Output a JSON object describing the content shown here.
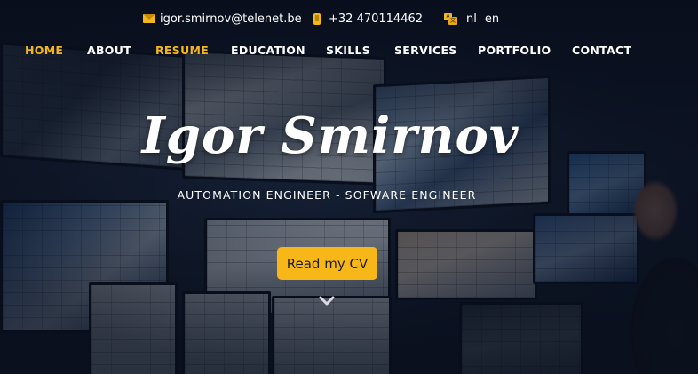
{
  "contact": {
    "email": "igor.smirnov@telenet.be",
    "phone": "+32 470114462",
    "languages": [
      "nl",
      "en"
    ]
  },
  "nav": {
    "items": [
      {
        "label": "HOME",
        "active": true
      },
      {
        "label": "ABOUT",
        "active": false
      },
      {
        "label": "RESUME",
        "active": true
      },
      {
        "label": "EDUCATION",
        "active": false
      },
      {
        "label": "SKILLS",
        "active": false
      },
      {
        "label": "SERVICES",
        "active": false
      },
      {
        "label": "PORTFOLIO",
        "active": false
      },
      {
        "label": "CONTACT",
        "active": false
      }
    ]
  },
  "hero": {
    "name": "Igor Smirnov",
    "subtitle": "AUTOMATION ENGINEER - SOFWARE ENGINEER",
    "cta_label": "Read my CV"
  },
  "icons": {
    "email": "envelope-icon",
    "phone": "mobile-phone-icon",
    "language": "language-icon",
    "scroll": "chevron-down-icon"
  },
  "colors": {
    "accent": "#f3b61b",
    "button": "#f8b718",
    "text": "#ffffff"
  }
}
